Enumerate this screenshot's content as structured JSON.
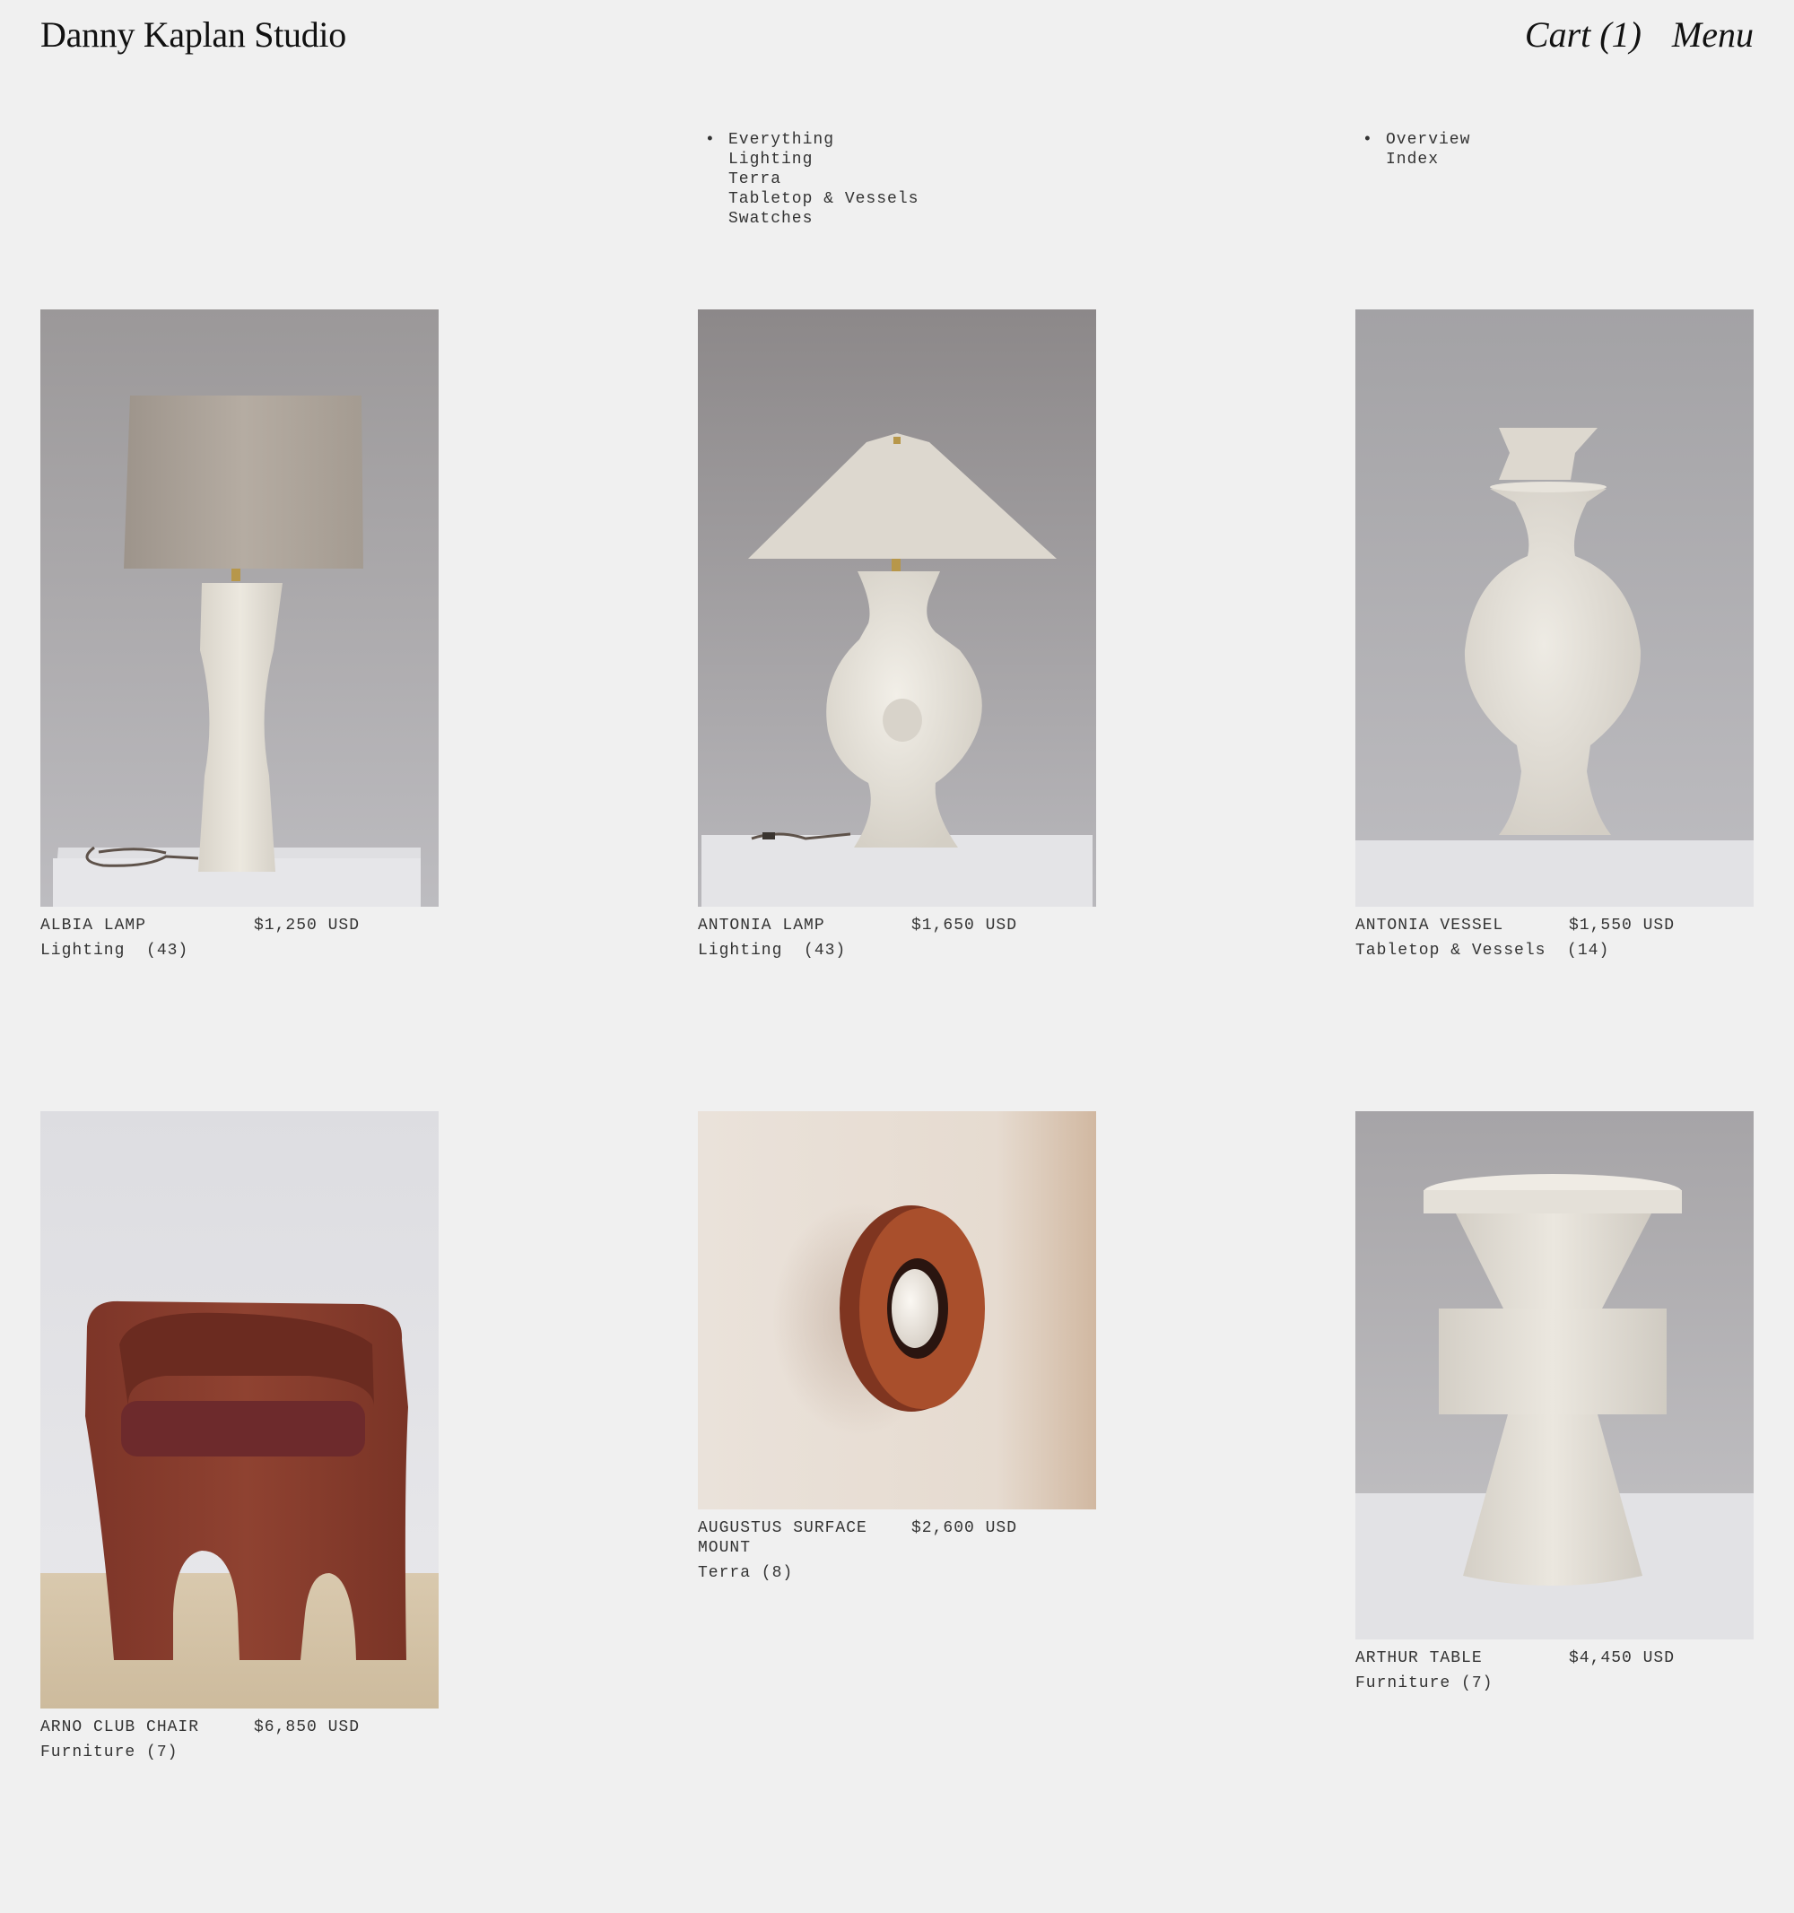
{
  "header": {
    "brand": "Danny Kaplan Studio",
    "cart_label": "Cart (1)",
    "menu_label": "Menu"
  },
  "nav": {
    "bullet": "•",
    "categories": [
      "Everything",
      "Lighting",
      "Terra",
      "Tabletop & Vessels",
      "Swatches"
    ],
    "views": [
      "Overview",
      "Index"
    ]
  },
  "products": [
    {
      "name": "ALBIA LAMP",
      "price": "$1,250 USD",
      "category": "Lighting  (43)",
      "icon": "table-lamp-drum-shade"
    },
    {
      "name": "ANTONIA LAMP",
      "price": "$1,650 USD",
      "category": "Lighting  (43)",
      "icon": "table-lamp-cone-shade"
    },
    {
      "name": "ANTONIA VESSEL",
      "price": "$1,550 USD",
      "category": "Tabletop & Vessels  (14)",
      "icon": "ceramic-vessel"
    },
    {
      "name": "ARNO CLUB CHAIR",
      "price": "$6,850 USD",
      "category": "Furniture (7)",
      "icon": "terracotta-club-chair"
    },
    {
      "name": "AUGUSTUS SURFACE MOUNT",
      "price": "$2,600 USD",
      "category": "Terra (8)",
      "icon": "terracotta-wall-sconce"
    },
    {
      "name": "ARTHUR TABLE",
      "price": "$4,450 USD",
      "category": "Furniture (7)",
      "icon": "ceramic-side-table"
    }
  ],
  "colors": {
    "background": "#f0f0f0",
    "text": "#333333",
    "terracotta": "#8a3d2c",
    "ceramic": "#e8e4dc"
  }
}
